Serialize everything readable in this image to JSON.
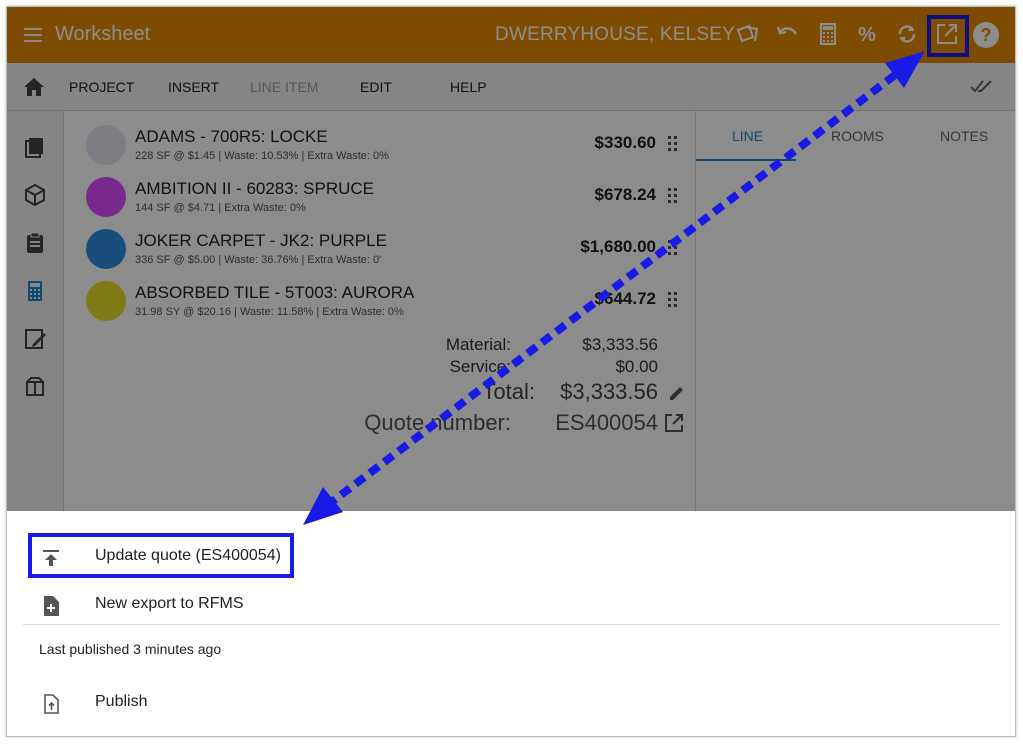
{
  "appbar": {
    "title": "Worksheet",
    "user": "DWERRYHOUSE, KELSEY",
    "icons": [
      "menu-icon",
      "cards-icon",
      "undo-icon",
      "calculator-icon",
      "percent-icon",
      "sync-icon",
      "export-icon",
      "help-icon"
    ],
    "percent_glyph": "%",
    "help_glyph": "?"
  },
  "toolbar": {
    "items": [
      {
        "label": "PROJECT",
        "enabled": true
      },
      {
        "label": "INSERT",
        "enabled": true
      },
      {
        "label": "LINE ITEM",
        "enabled": false
      },
      {
        "label": "EDIT",
        "enabled": true
      },
      {
        "label": "HELP",
        "enabled": true
      }
    ]
  },
  "leftnav": {
    "icons": [
      "layers-icon",
      "box-icon",
      "clipboard-icon",
      "calculator-icon",
      "edit-document-icon",
      "packages-icon"
    ],
    "active_index": 3
  },
  "sidepanel": {
    "tabs": [
      {
        "label": "LINE"
      },
      {
        "label": "ROOMS"
      },
      {
        "label": "NOTES"
      }
    ],
    "active_tab": "LINE"
  },
  "line_items": [
    {
      "name": "ADAMS - 700R5: LOCKE",
      "details": "228 SF @ $1.45 | Waste: 10.53% | Extra Waste: 0%",
      "price": "$330.60",
      "color": "#e3e3f0"
    },
    {
      "name": "AMBITION II - 60283: SPRUCE",
      "details": "144 SF @ $4.71 | Extra Waste: 0%",
      "price": "$678.24",
      "color": "#d94dff"
    },
    {
      "name": "JOKER CARPET - JK2: PURPLE",
      "details": "336 SF @ $5.00 | Waste: 36.76% | Extra Waste: 0'",
      "price": "$1,680.00",
      "color": "#2f8fe0"
    },
    {
      "name": "ABSORBED TILE - 5T003: AURORA",
      "details": "31.98 SY @ $20.16 | Waste: 11.58% | Extra Waste: 0%",
      "price": "$644.72",
      "color": "#e8e02a"
    }
  ],
  "totals": {
    "material_label": "Material:",
    "material": "$3,333.56",
    "service_label": "Service:",
    "service": "$0.00",
    "total_label": "Total:",
    "total": "$3,333.56",
    "quote_label": "Quote number:",
    "quote_number": "ES400054"
  },
  "sheet": {
    "update_label": "Update quote (ES400054)",
    "new_export_label": "New export to RFMS",
    "last_published": "Last published 3 minutes ago",
    "publish_label": "Publish"
  },
  "annotation_color": "#1a1ae6"
}
